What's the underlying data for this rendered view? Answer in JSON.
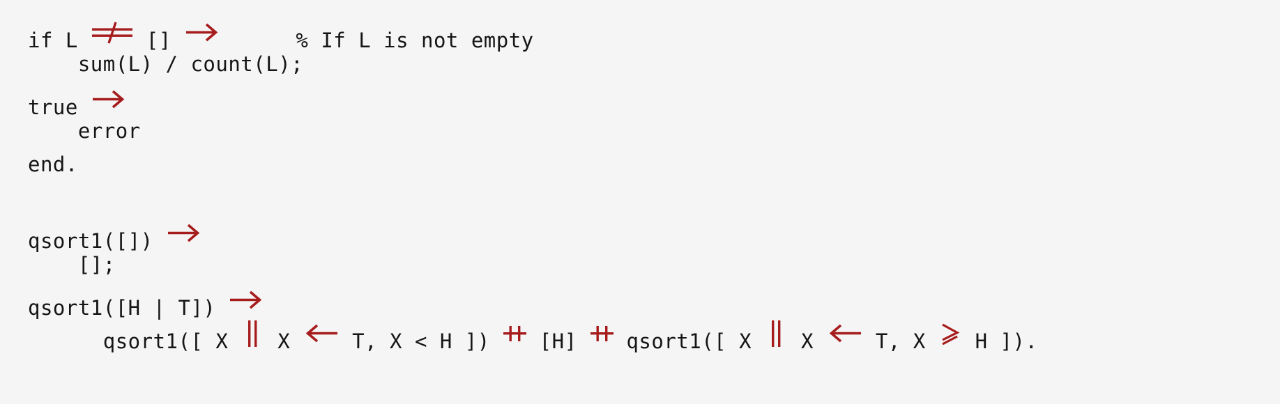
{
  "editor": {
    "background_color": "#f5f5f5",
    "text_color": "#151515",
    "ligature_color": "#a61c1c",
    "language": "erlang",
    "font_size_px": 29,
    "line_height_px": 48
  },
  "code": {
    "lines": [
      {
        "index": 1,
        "text": "if L ≠ [] →        % If L is not empty",
        "segments": [
          {
            "kind": "text",
            "value": "if L "
          },
          {
            "kind": "lig",
            "value": "≠",
            "glyph": "not-equal"
          },
          {
            "kind": "text",
            "value": " [] "
          },
          {
            "kind": "lig",
            "value": "→",
            "glyph": "right-arrow"
          },
          {
            "kind": "text",
            "value": "      % If L is not empty"
          }
        ]
      },
      {
        "index": 2,
        "text": "    sum(L) / count(L);",
        "segments": [
          {
            "kind": "text",
            "value": "    sum(L) / count(L);"
          }
        ]
      },
      {
        "index": 3,
        "text": "true →",
        "segments": [
          {
            "kind": "text",
            "value": "true "
          },
          {
            "kind": "lig",
            "value": "→",
            "glyph": "right-arrow"
          }
        ]
      },
      {
        "index": 4,
        "text": "    error",
        "segments": [
          {
            "kind": "text",
            "value": "    error"
          }
        ]
      },
      {
        "index": 5,
        "text": "end.",
        "segments": [
          {
            "kind": "text",
            "value": "end."
          }
        ]
      },
      {
        "index": 6,
        "text": "",
        "segments": []
      },
      {
        "index": 7,
        "text": "qsort1([]) →",
        "segments": [
          {
            "kind": "text",
            "value": "qsort1([]) "
          },
          {
            "kind": "lig",
            "value": "→",
            "glyph": "right-arrow"
          }
        ]
      },
      {
        "index": 8,
        "text": "    [];",
        "segments": [
          {
            "kind": "text",
            "value": "    [];"
          }
        ]
      },
      {
        "index": 9,
        "text": "qsort1([H | T]) →",
        "segments": [
          {
            "kind": "text",
            "value": "qsort1([H | T]) "
          },
          {
            "kind": "lig",
            "value": "→",
            "glyph": "right-arrow"
          }
        ]
      },
      {
        "index": 10,
        "text": "      qsort1([ X || X ← T, X < H ]) ++ [H] ++ qsort1([ X || X ← T, X ≥ H ]).",
        "segments": [
          {
            "kind": "text",
            "value": "      qsort1([ X "
          },
          {
            "kind": "lig",
            "value": "||",
            "glyph": "double-pipe"
          },
          {
            "kind": "text",
            "value": " X "
          },
          {
            "kind": "lig",
            "value": "←",
            "glyph": "left-arrow"
          },
          {
            "kind": "text",
            "value": " T, X < H ]) "
          },
          {
            "kind": "lig",
            "value": "++",
            "glyph": "plus-plus"
          },
          {
            "kind": "text",
            "value": " [H] "
          },
          {
            "kind": "lig",
            "value": "++",
            "glyph": "plus-plus"
          },
          {
            "kind": "text",
            "value": " qsort1([ X "
          },
          {
            "kind": "lig",
            "value": "||",
            "glyph": "double-pipe"
          },
          {
            "kind": "text",
            "value": " X "
          },
          {
            "kind": "lig",
            "value": "←",
            "glyph": "left-arrow"
          },
          {
            "kind": "text",
            "value": " T, X "
          },
          {
            "kind": "lig",
            "value": "≥",
            "glyph": "greater-equal"
          },
          {
            "kind": "text",
            "value": " H ])."
          }
        ]
      }
    ]
  }
}
